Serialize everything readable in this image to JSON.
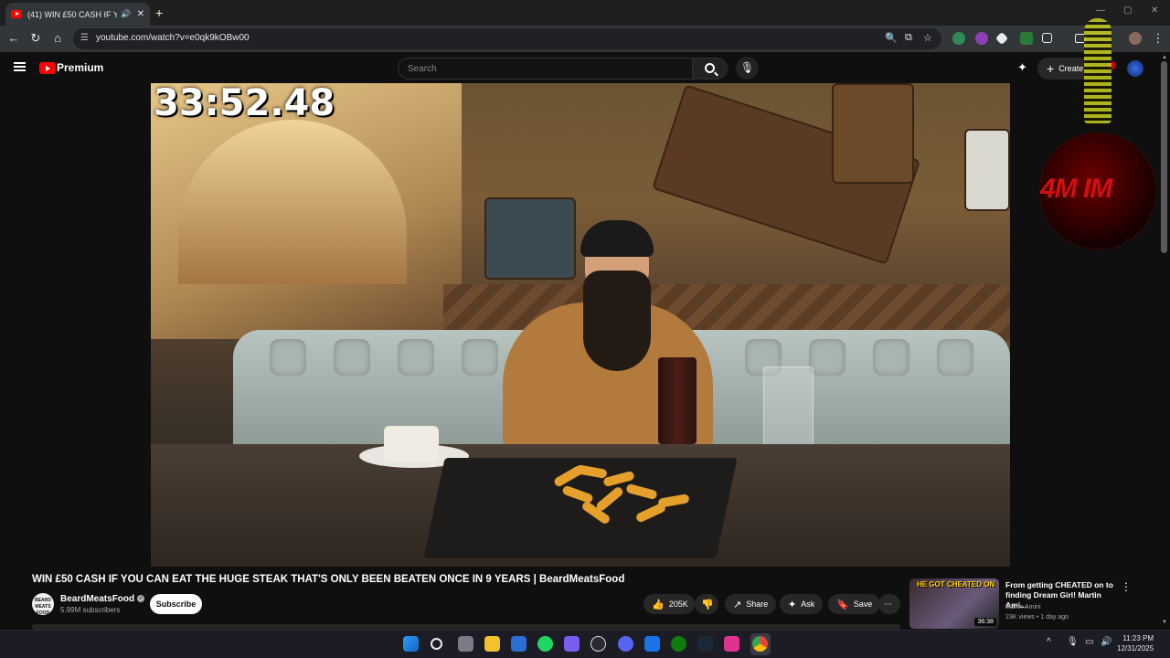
{
  "browser": {
    "tab_title": "(41) WIN £50 CASH IF YOU",
    "new_tab_icon": "+",
    "url": "youtube.com/watch?v=e0qk9kOBw00"
  },
  "youtube": {
    "brand": "Premium",
    "search_placeholder": "Search",
    "create_label": "Create"
  },
  "video": {
    "timer": "33:52.48",
    "overlay_text": "4M IM",
    "title": "WIN £50 CASH IF YOU CAN EAT THE HUGE STEAK THAT'S ONLY BEEN BEATEN ONCE IN 9 YEARS | BeardMeatsFood",
    "channel_name": "BeardMeatsFood",
    "channel_avatar_text": "BEARD MEATS FOOD",
    "subscribers": "5.99M subscribers",
    "subscribe_label": "Subscribe",
    "likes": "205K",
    "share_label": "Share",
    "ask_label": "Ask",
    "save_label": "Save"
  },
  "recommendation": {
    "thumb_text": "HE GOT CHEATED ON",
    "duration": "36:38",
    "title": "From getting CHEATED on to finding Dream Girl! Martin Ami...",
    "author": "Martin Amini",
    "meta": "23K views • 1 day ago"
  },
  "taskbar": {
    "time": "11:23 PM",
    "date": "12/31/2025"
  }
}
